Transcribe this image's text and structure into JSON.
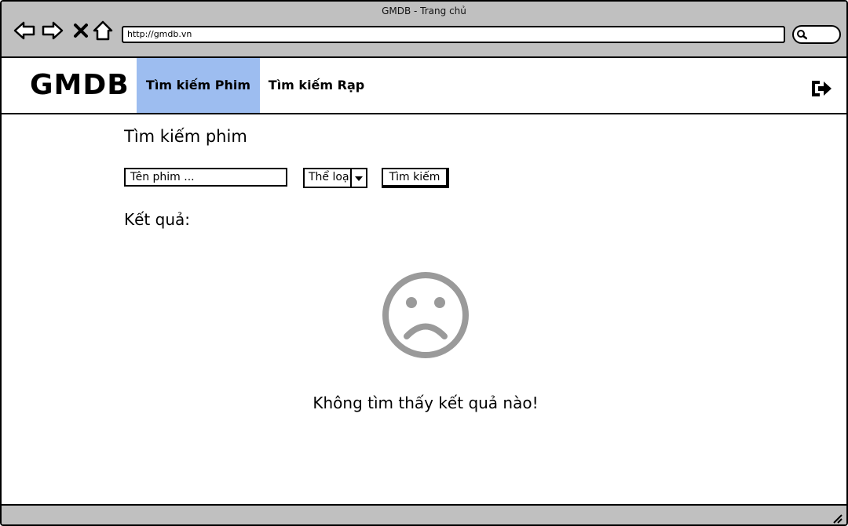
{
  "window": {
    "title": "GMDB - Trang chủ",
    "url": "http://gmdb.vn"
  },
  "icons": {
    "back": "back-arrow-icon",
    "forward": "forward-arrow-icon",
    "stop": "close-icon",
    "home": "home-icon",
    "search": "search-icon",
    "logout": "logout-icon",
    "empty_state": "sad-face-icon",
    "dropdown": "chevron-down-icon",
    "resize": "resize-grip-icon"
  },
  "header": {
    "logo": "GMDB",
    "tabs": [
      {
        "label": "Tìm kiếm Phim",
        "active": true
      },
      {
        "label": "Tìm kiếm Rạp",
        "active": false
      }
    ]
  },
  "colors": {
    "active_tab": "#9dbdf0",
    "chrome": "#c0c0c0",
    "empty_icon": "#9a9a9a"
  },
  "main": {
    "title": "Tìm kiếm phim",
    "name_input": {
      "placeholder": "Tên phim ...",
      "value": ""
    },
    "genre_select": {
      "value": "Thể loại"
    },
    "search_button": "Tìm kiếm",
    "results_label": "Kết quả:",
    "empty_message": "Không tìm thấy kết quả nào!"
  }
}
